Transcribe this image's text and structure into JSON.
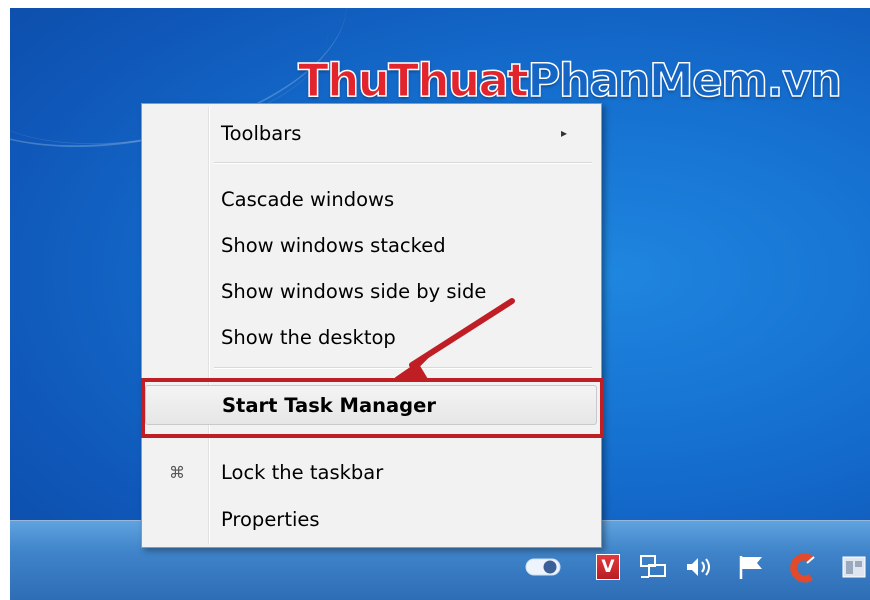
{
  "watermark": {
    "part1": "ThuThuat",
    "part2": "PhanMem.vn"
  },
  "menu": {
    "items": [
      {
        "label": "Toolbars"
      },
      {
        "label": "Cascade windows"
      },
      {
        "label": "Show windows stacked"
      },
      {
        "label": "Show windows side by side"
      },
      {
        "label": "Show the desktop"
      },
      {
        "label": "Start Task Manager"
      },
      {
        "label": "Lock the taskbar"
      },
      {
        "label": "Properties"
      }
    ],
    "lock_glyph": "⌘",
    "submenu_glyph": "▸"
  },
  "annotation_color": "#bf1e24",
  "tray": {
    "icons": [
      "toggle-icon",
      "antivirus-icon",
      "network-icon",
      "volume-icon",
      "flag-icon",
      "ccleaner-icon",
      "window-icon"
    ],
    "antivirus_letter": "V"
  }
}
